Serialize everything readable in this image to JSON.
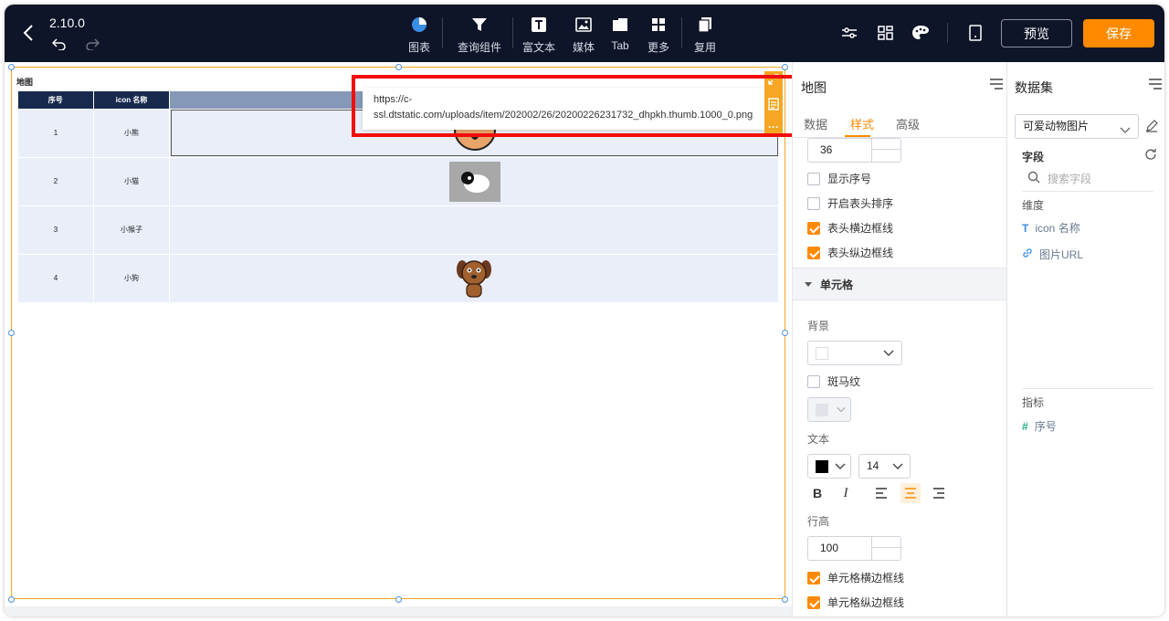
{
  "header": {
    "version": "2.10.0",
    "tools": [
      "图表",
      "查询组件",
      "富文本",
      "媒体",
      "Tab",
      "更多",
      "复用"
    ],
    "preview_label": "预览",
    "save_label": "保存"
  },
  "canvas": {
    "widget_title": "地图",
    "table": {
      "columns": [
        "序号",
        "icon 名称",
        ""
      ],
      "rows": [
        {
          "index": "1",
          "name": "小熊"
        },
        {
          "index": "2",
          "name": "小猫"
        },
        {
          "index": "3",
          "name": "小猴子"
        },
        {
          "index": "4",
          "name": "小狗"
        }
      ]
    },
    "url_popup": {
      "line1": "https://c-",
      "line2": "ssl.dtstatic.com/uploads/item/202002/26/20200226231732_dhpkh.thumb.1000_0.png"
    }
  },
  "style_panel": {
    "title": "地图",
    "tabs": [
      "数据",
      "样式",
      "高级"
    ],
    "active_tab": "样式",
    "header_height": "36",
    "checks": {
      "show_index": "显示序号",
      "header_sort": "开启表头排序",
      "header_h_border": "表头横边框线",
      "header_v_border": "表头纵边框线"
    },
    "cell_section": "单元格",
    "background_label": "背景",
    "zebra_label": "斑马纹",
    "text_label": "文本",
    "font_size": "14",
    "bold_label": "B",
    "italic_label": "I",
    "line_height_label": "行高",
    "line_height": "100",
    "cell_h_border": "单元格横边框线",
    "cell_v_border": "单元格纵边框线"
  },
  "dataset_panel": {
    "title": "数据集",
    "selected_dataset": "可爱动物图片",
    "fields_label": "字段",
    "search_placeholder": "搜索字段",
    "dimension_label": "维度",
    "dimensions": [
      "icon 名称",
      "图片URL"
    ],
    "metric_label": "指标",
    "metrics": [
      "序号"
    ]
  },
  "colors": {
    "accent": "#ff8a00",
    "topbar": "#0f1528",
    "table_header": "#172a4e",
    "highlight": "#f20d0d"
  }
}
